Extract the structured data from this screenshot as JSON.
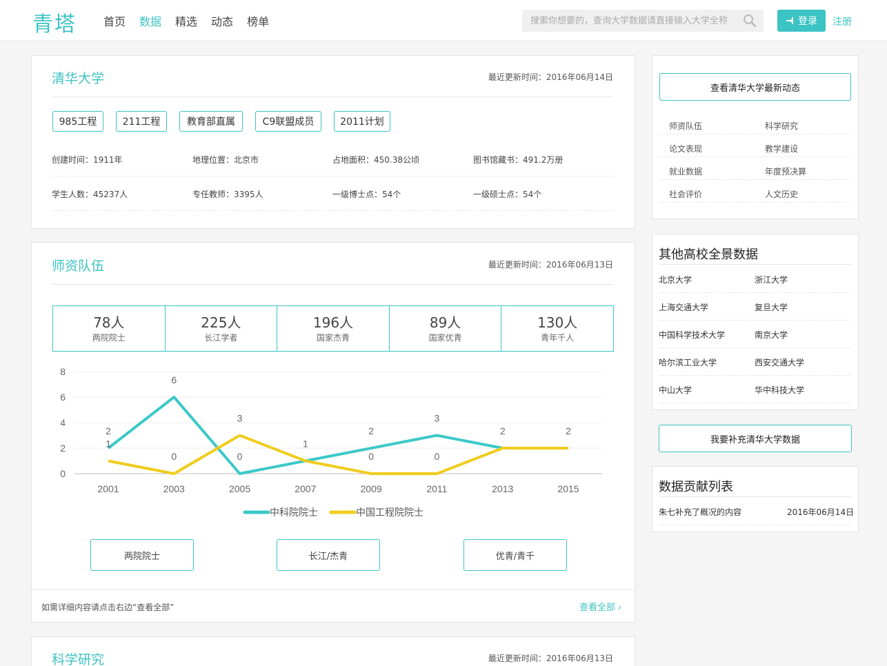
{
  "header": {
    "logo": "青塔",
    "nav": [
      "首页",
      "数据",
      "精选",
      "动态",
      "榜单"
    ],
    "search_placeholder": "搜索你想要的，查询大学数据请直接输入大学全称",
    "login": "登录",
    "register": "注册",
    "accent": "#3cc3c3"
  },
  "overview": {
    "title": "清华大学",
    "updated": "最近更新时间：2016年06月14日",
    "tags": [
      "985工程",
      "211工程",
      "教育部直属",
      "C9联盟成员",
      "2011计划"
    ],
    "facts": [
      "创建时间：1911年",
      "地理位置：北京市",
      "占地面积：450.38公顷",
      "图书馆藏书：491.2万册",
      "学生人数：45237人",
      "专任教师：3395人",
      "一级博士点：54个",
      "一级硕士点：54个"
    ]
  },
  "faculty": {
    "title": "师资队伍",
    "updated": "最近更新时间：2016年06月13日",
    "stats": [
      {
        "num": "78人",
        "label": "两院院士"
      },
      {
        "num": "225人",
        "label": "长江学者"
      },
      {
        "num": "196人",
        "label": "国家杰青"
      },
      {
        "num": "89人",
        "label": "国家优青"
      },
      {
        "num": "130人",
        "label": "青年千人"
      }
    ],
    "buttons": [
      "两院院士",
      "长江/杰青",
      "优青/青千"
    ],
    "footer_note": "如需详细内容请点击右边“查看全部”",
    "view_all": "查看全部 ›"
  },
  "research": {
    "title": "科学研究",
    "updated": "最近更新时间：2016年06月13日"
  },
  "chart_data": {
    "type": "line",
    "x": [
      "2001",
      "2003",
      "2005",
      "2007",
      "2009",
      "2011",
      "2013",
      "2015"
    ],
    "yticks": [
      0,
      2,
      4,
      6,
      8
    ],
    "ylim": [
      0,
      8
    ],
    "series": [
      {
        "name": "中科院院士",
        "color": "#3cc8c8",
        "values": [
          2,
          6,
          0,
          1,
          2,
          3,
          2,
          2
        ]
      },
      {
        "name": "中国工程院院士",
        "color": "#f0cc1e",
        "values": [
          1,
          0,
          3,
          1,
          0,
          0,
          2,
          2
        ]
      }
    ],
    "legend_position": "bottom"
  },
  "sidebar": {
    "latest_btn": "查看清华大学最新动态",
    "links": [
      "师资队伍",
      "科学研究",
      "论文表现",
      "教学建设",
      "就业数据",
      "年度预决算",
      "社会评价",
      "人文历史"
    ],
    "others_title": "其他高校全景数据",
    "others": [
      "北京大学",
      "浙江大学",
      "上海交通大学",
      "复旦大学",
      "中国科学技术大学",
      "南京大学",
      "哈尔滨工业大学",
      "西安交通大学",
      "中山大学",
      "华中科技大学"
    ],
    "supplement_btn": "我要补充清华大学数据",
    "contrib_title": "数据贡献列表",
    "contrib_text": "朱七补充了概况的内容",
    "contrib_date": "2016年06月14日"
  }
}
